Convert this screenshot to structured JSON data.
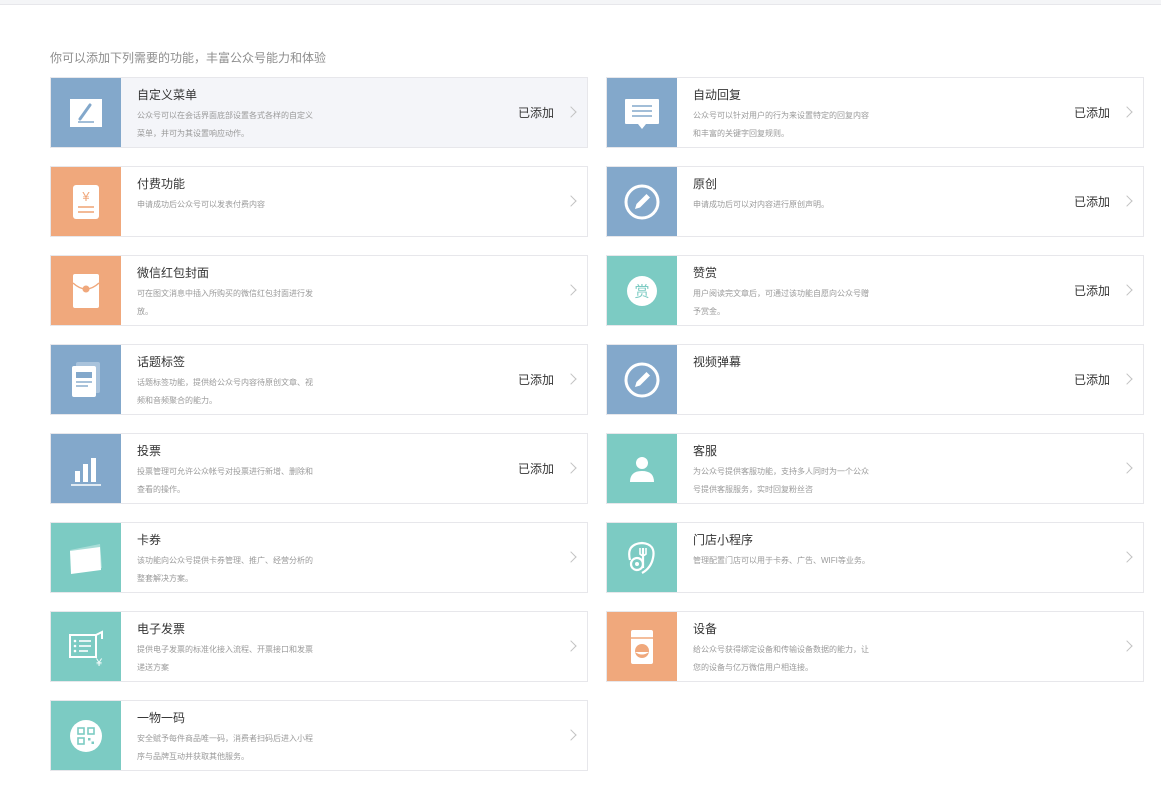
{
  "header": {
    "intro": "你可以添加下列需要的功能，丰富公众号能力和体验"
  },
  "colors": {
    "blue": "#83a8cb",
    "orange": "#f0a87c",
    "teal": "#7ccbc3",
    "border": "#e7e7eb"
  },
  "features": [
    {
      "title": "自定义菜单",
      "desc": "公众号可以在会话界面底部设置各式各样的自定义菜单，并可为其设置响应动作。",
      "status": "已添加",
      "icon": "edit-icon",
      "color": "#83a8cb"
    },
    {
      "title": "自动回复",
      "desc": "公众号可以针对用户的行为来设置特定的回复内容和丰富的关键字回复规则。",
      "status": "已添加",
      "icon": "message-icon",
      "color": "#83a8cb"
    },
    {
      "title": "付费功能",
      "desc": "申请成功后公众号可以发表付费内容",
      "status": "",
      "icon": "yen-receipt-icon",
      "color": "#f0a87c"
    },
    {
      "title": "原创",
      "desc": "申请成功后可以对内容进行原创声明。",
      "status": "已添加",
      "icon": "pen-circle-icon",
      "color": "#83a8cb"
    },
    {
      "title": "微信红包封面",
      "desc": "可在图文消息中插入所购买的微信红包封面进行发放。",
      "status": "",
      "icon": "red-envelope-icon",
      "color": "#f0a87c"
    },
    {
      "title": "赞赏",
      "desc": "用户阅读完文章后，可通过该功能自愿向公众号赠予赏金。",
      "status": "已添加",
      "icon": "reward-icon",
      "icon_char": "赏",
      "color": "#7ccbc3"
    },
    {
      "title": "话题标签",
      "desc": "话题标签功能，提供给公众号内容待原创文章、视频和音频聚合的能力。",
      "status": "已添加",
      "icon": "tag-document-icon",
      "color": "#83a8cb"
    },
    {
      "title": "视频弹幕",
      "desc": "",
      "status": "已添加",
      "icon": "pen-circle-icon",
      "color": "#83a8cb"
    },
    {
      "title": "投票",
      "desc": "投票管理可允许公众帐号对投票进行新增、删除和查看的操作。",
      "status": "已添加",
      "icon": "bar-chart-icon",
      "color": "#83a8cb"
    },
    {
      "title": "客服",
      "desc": "为公众号提供客服功能，支持多人同时为一个公众号提供客服服务，实时回复粉丝咨",
      "status": "",
      "icon": "user-icon",
      "color": "#7ccbc3"
    },
    {
      "title": "卡券",
      "desc": "该功能向公众号提供卡券管理、推广、经营分析的整套解决方案。",
      "status": "",
      "icon": "card-icon",
      "color": "#7ccbc3"
    },
    {
      "title": "门店小程序",
      "desc": "管理配置门店可以用于卡券、广告、WIFI等业务。",
      "status": "",
      "icon": "store-fork-icon",
      "color": "#7ccbc3"
    },
    {
      "title": "电子发票",
      "desc": "提供电子发票的标准化接入流程、开票接口和发票递送方案",
      "status": "",
      "icon": "invoice-icon",
      "color": "#7ccbc3"
    },
    {
      "title": "设备",
      "desc": "给公众号获得绑定设备和传输设备数据的能力，让您的设备与亿万微信用户相连接。",
      "status": "",
      "icon": "device-icon",
      "color": "#f0a87c"
    },
    {
      "title": "一物一码",
      "desc": "安全赋予每件商品唯一码，消费者扫码后进入小程序与品牌互动并获取其他服务。",
      "status": "",
      "icon": "qrcode-icon",
      "color": "#7ccbc3"
    }
  ]
}
